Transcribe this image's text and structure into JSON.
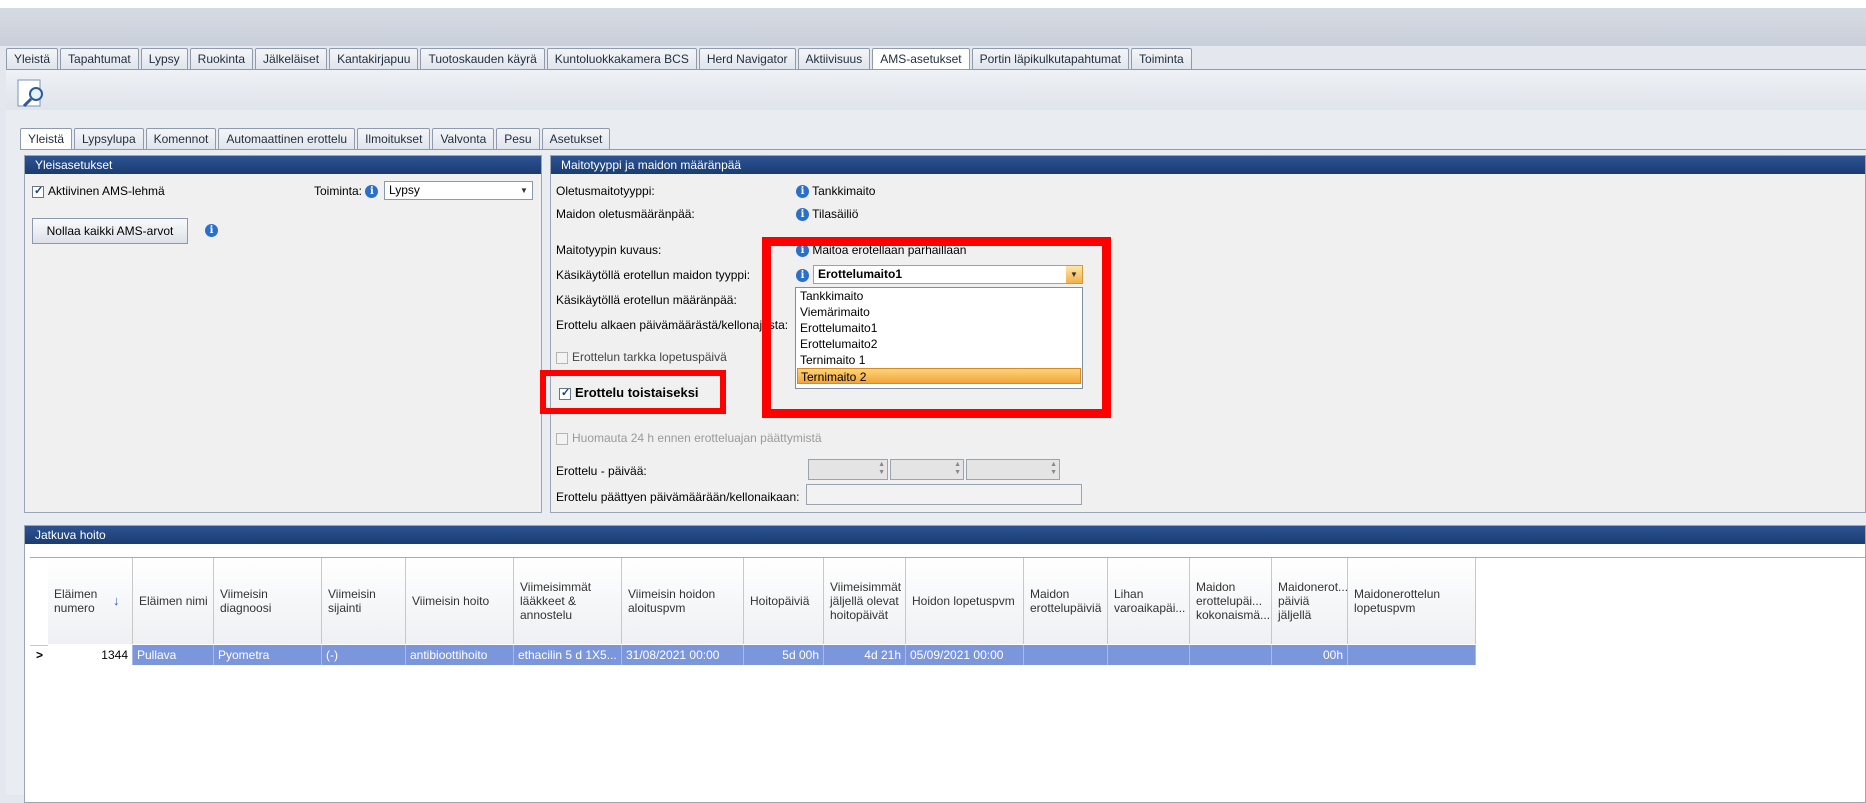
{
  "main_tabs": [
    "Yleistä",
    "Tapahtumat",
    "Lypsy",
    "Ruokinta",
    "Jälkeläiset",
    "Kantakirjapuu",
    "Tuotoskauden käyrä",
    "Kuntoluokkakamera BCS",
    "Herd Navigator",
    "Aktiivisuus",
    "AMS-asetukset",
    "Portin läpikulkutapahtumat",
    "Toiminta"
  ],
  "main_active": "AMS-asetukset",
  "sub_tabs": [
    "Yleistä",
    "Lypsylupa",
    "Komennot",
    "Automaattinen erottelu",
    "Ilmoitukset",
    "Valvonta",
    "Pesu",
    "Asetukset"
  ],
  "sub_active": "Yleistä",
  "general": {
    "title": "Yleisasetukset",
    "active_label": "Aktiivinen AMS-lehmä",
    "active_checked": true,
    "action_label": "Toiminta:",
    "action_value": "Lypsy",
    "reset_button": "Nollaa kaikki AMS-arvot"
  },
  "milk": {
    "title": "Maitotyyppi ja maidon määränpää",
    "default_type_label": "Oletusmaitotyyppi:",
    "default_type_value": "Tankkimaito",
    "default_dest_label": "Maidon oletusmääränpää:",
    "default_dest_value": "Tilasäiliö",
    "desc_label": "Maitotyypin kuvaus:",
    "desc_value": "Maitoa erotellaan parhaillaan",
    "manual_type_label": "Käsikäytöllä erotellun maidon tyyppi:",
    "manual_type_value": "Erottelumaito1",
    "manual_dest_label": "Käsikäytöllä erotellun määränpää:",
    "from_label": "Erottelu alkaen päivämäärästä/kellonajasta:",
    "exact_end_label": "Erottelun tarkka lopetuspäivä",
    "until_further_label": "Erottelu toistaiseksi",
    "notify_label": "Huomauta 24 h ennen erotteluajan päättymistä",
    "days_label": "Erottelu - päivää:",
    "end_label": "Erottelu päättyen päivämäärään/kellonaikaan:",
    "dropdown_options": [
      "Tankkimaito",
      "Viemärimaito",
      "Erottelumaito1",
      "Erottelumaito2",
      "Ternimaito 1",
      "Ternimaito 2"
    ],
    "dropdown_highlight": "Ternimaito 2"
  },
  "care": {
    "title": "Jatkuva hoito",
    "columns": [
      "Eläimen numero",
      "Eläimen nimi",
      "Viimeisin diagnoosi",
      "Viimeisin sijainti",
      "Viimeisin hoito",
      "Viimeisimmät lääkkeet & annostelu",
      "Viimeisin hoidon aloituspvm",
      "Hoitopäiviä",
      "Viimeisimmät jäljellä olevat hoitopäivät",
      "Hoidon lopetuspvm",
      "Maidon erottelupäiviä",
      "Lihan varoaikapäi...",
      "Maidon erottelupäi... kokonaismä...",
      "Maidonerot... päiviä jäljellä",
      "Maidonerottelun lopetuspvm"
    ],
    "row": [
      "1344",
      "Pullava",
      "Pyometra",
      "(-)",
      "antibioottihoito",
      "ethacilin 5 d 1X5...",
      "31/08/2021 00:00",
      "5d 00h",
      "4d 21h",
      "05/09/2021 00:00",
      "",
      "",
      "",
      "00h",
      ""
    ],
    "row_marker": ">",
    "sort_icon": "arrow-down-icon"
  }
}
